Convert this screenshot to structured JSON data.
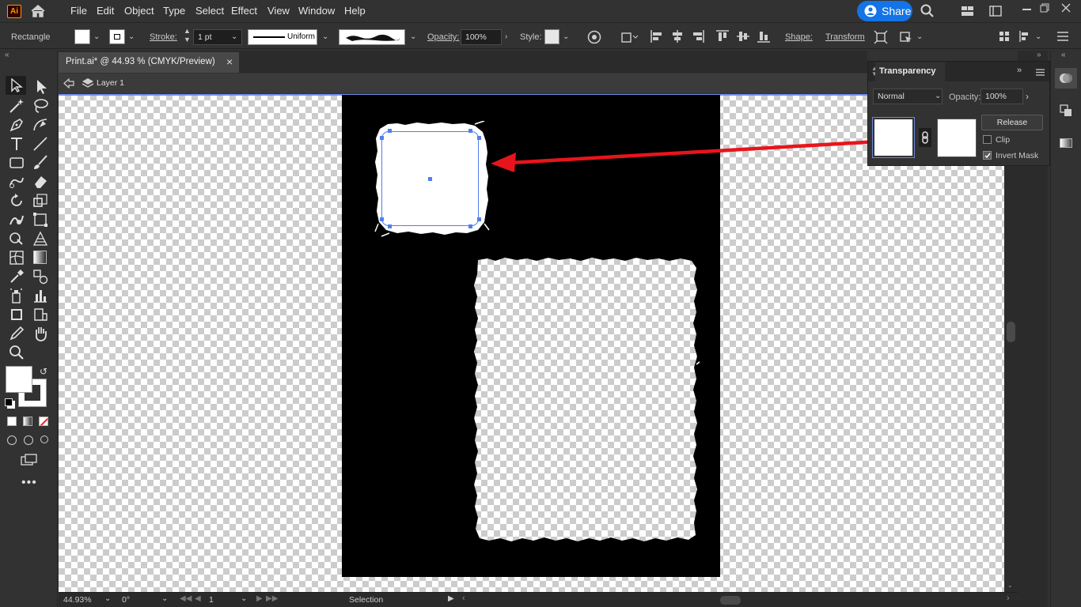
{
  "menubar": {
    "app_logo": "Ai",
    "items": [
      "File",
      "Edit",
      "Object",
      "Type",
      "Select",
      "Effect",
      "View",
      "Window",
      "Help"
    ],
    "share_label": "Share"
  },
  "control": {
    "tool_name": "Rectangle",
    "stroke_label": "Stroke:",
    "stroke_weight": "1 pt",
    "stroke_profile": "Uniform",
    "opacity_label": "Opacity:",
    "opacity_value": "100%",
    "style_label": "Style:",
    "shape_label": "Shape:",
    "transform_label": "Transform"
  },
  "document": {
    "tab_title": "Print.ai* @ 44.93 % (CMYK/Preview)",
    "layer_name": "Layer 1"
  },
  "transparency": {
    "title": "Transparency",
    "blend_mode": "Normal",
    "opacity_label": "Opacity:",
    "opacity_value": "100%",
    "release_label": "Release",
    "clip_label": "Clip",
    "clip_checked": false,
    "invert_label": "Invert Mask",
    "invert_checked": true
  },
  "status": {
    "zoom": "44.93%",
    "rotation": "0°",
    "artboard": "1",
    "tool": "Selection"
  },
  "colors": {
    "accent": "#1473e6",
    "selection": "#4f7ff0",
    "arrow": "#e8141c",
    "artboard": "#000000"
  }
}
